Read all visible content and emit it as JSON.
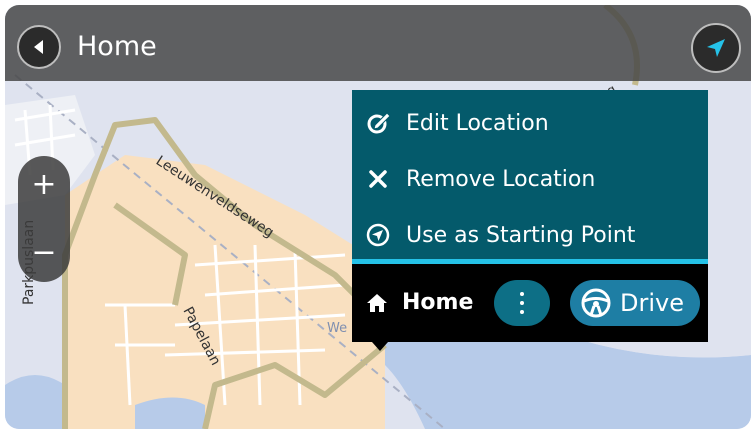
{
  "header": {
    "title": "Home",
    "back_icon": "back-arrow-icon",
    "nav_icon": "navigation-arrow-icon"
  },
  "zoom": {
    "in_label": "+",
    "out_label": "−"
  },
  "map": {
    "street_labels": [
      "Leeuwenveldseweg",
      "Papelaan",
      "Parkpuslaan",
      "eg",
      "We"
    ],
    "colors": {
      "land": "#f9e0c0",
      "water": "#c9d7ef",
      "road": "#c3b98d",
      "river": "#b7cbe9"
    }
  },
  "popup": {
    "menu": [
      {
        "label": "Edit Location",
        "icon": "edit-location-icon"
      },
      {
        "label": "Remove Location",
        "icon": "close-icon"
      },
      {
        "label": "Use as Starting Point",
        "icon": "starting-point-icon"
      }
    ],
    "location_label": "Home",
    "location_icon": "home-icon",
    "more_icon": "more-vertical-icon",
    "drive_label": "Drive",
    "drive_icon": "steering-wheel-icon",
    "colors": {
      "panel": "#045a6b",
      "accent": "#25c2e8",
      "drive_button": "#1e7ea4",
      "more_button": "#0d6f86"
    }
  }
}
